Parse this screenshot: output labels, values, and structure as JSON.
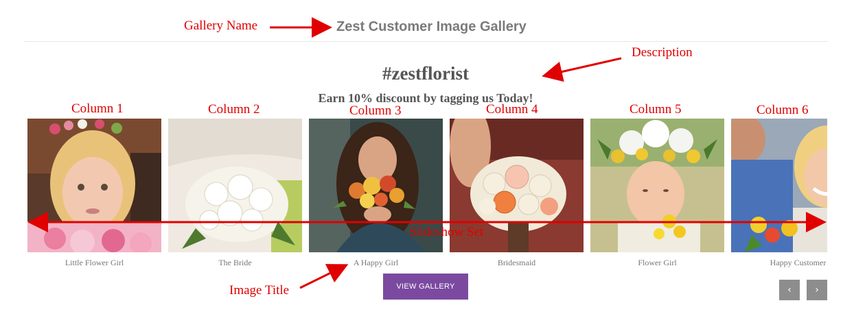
{
  "gallery": {
    "name": "Zest Customer Image Gallery",
    "description_title": "#zestflorist",
    "description_subtitle": "Earn 10% discount by tagging us Today!",
    "view_button_label": "VIEW GALLERY",
    "prev_icon": "‹",
    "next_icon": "›"
  },
  "images": [
    {
      "title": "Little Flower Girl"
    },
    {
      "title": "The Bride"
    },
    {
      "title": "A Happy Girl"
    },
    {
      "title": "Bridesmaid"
    },
    {
      "title": "Flower Girl"
    },
    {
      "title": "Happy Customer"
    }
  ],
  "annotations": {
    "gallery_name": "Gallery Name",
    "description": "Description",
    "columns": [
      "Column 1",
      "Column 2",
      "Column 3",
      "Column 4",
      "Column 5",
      "Column 6"
    ],
    "slideshow_set": "Slideshow Set",
    "image_title": "Image Title"
  },
  "colors": {
    "accent": "#7b4aa0",
    "annotation": "#e00000",
    "nav": "#8d8d8d"
  }
}
